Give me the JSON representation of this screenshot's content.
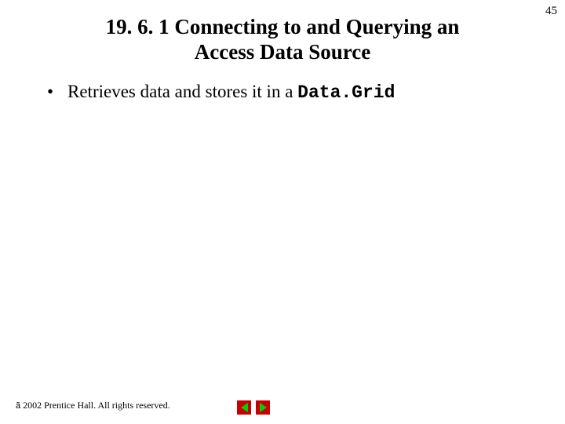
{
  "page_number": "45",
  "title_line1": "19. 6. 1 Connecting to and Querying an",
  "title_line2": "Access Data Source",
  "bullet": {
    "text_before": "Retrieves data and stores it in a ",
    "code": "Data.Grid"
  },
  "footer": {
    "copy_symbol": "ã",
    "text": " 2002 Prentice Hall. All rights reserved."
  },
  "nav": {
    "prev": "previous-slide",
    "next": "next-slide"
  }
}
